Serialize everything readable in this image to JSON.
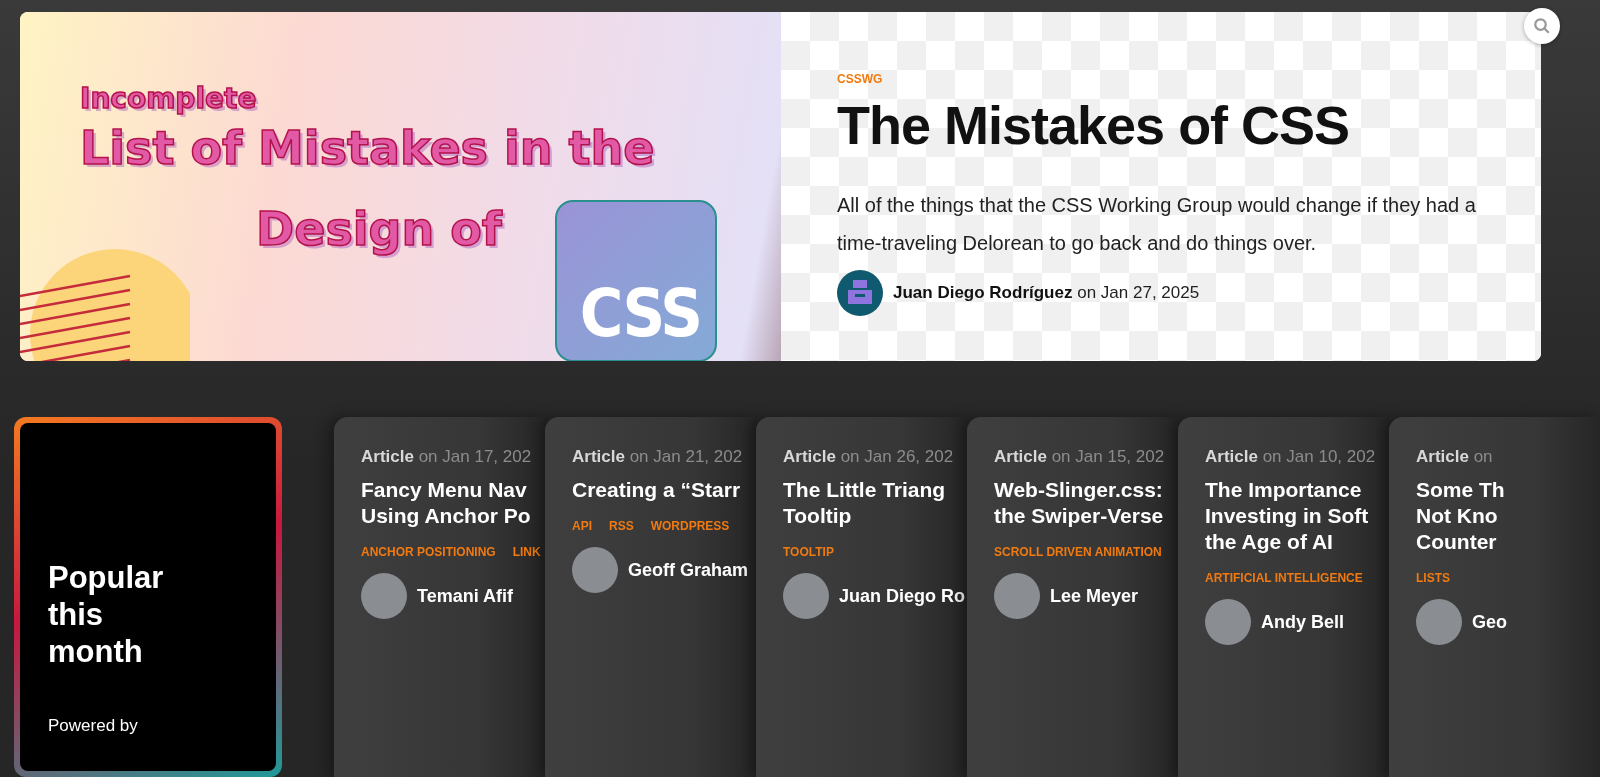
{
  "hero": {
    "image": {
      "kicker": "Incomplete",
      "headline": "List of Mistakes in the",
      "headline_2": "Design of",
      "logo_text": "CSS"
    },
    "category": "CSSWG",
    "title": "The Mistakes of CSS",
    "description": "All of the things that the CSS Working Group would change if they had a time-traveling Delorean to go back and do things over.",
    "author": "Juan Diego Rodríguez",
    "date": "on Jan 27, 2025"
  },
  "popular": {
    "heading": "Popular this month",
    "footer": "Powered by"
  },
  "cards": [
    {
      "type": "Article",
      "date": "on Jan 17, 202",
      "title_lines": [
        "Fancy Menu Nav",
        "Using Anchor Po"
      ],
      "tags": [
        "ANCHOR POSITIONING",
        "LINK"
      ],
      "author": "Temani Afif"
    },
    {
      "type": "Article",
      "date": "on Jan 21, 202",
      "title_lines": [
        "Creating a “Starr"
      ],
      "tags": [
        "API",
        "RSS",
        "WORDPRESS"
      ],
      "author": "Geoff Graham"
    },
    {
      "type": "Article",
      "date": "on Jan 26, 202",
      "title_lines": [
        "The Little Triang",
        "Tooltip"
      ],
      "tags": [
        "TOOLTIP"
      ],
      "author": "Juan Diego Ro"
    },
    {
      "type": "Article",
      "date": "on Jan 15, 202",
      "title_lines": [
        "Web-Slinger.css:",
        "the Swiper-Verse"
      ],
      "tags": [
        "SCROLL DRIVEN ANIMATION"
      ],
      "author": "Lee Meyer"
    },
    {
      "type": "Article",
      "date": "on Jan 10, 202",
      "title_lines": [
        "The Importance",
        "Investing in Soft",
        "the Age of AI"
      ],
      "tags": [
        "ARTIFICIAL INTELLIGENCE"
      ],
      "author": "Andy Bell"
    },
    {
      "type": "Article",
      "date": "on",
      "title_lines": [
        "Some Th",
        "Not Kno",
        "Counter"
      ],
      "tags": [
        "LISTS"
      ],
      "author": "Geo"
    }
  ]
}
